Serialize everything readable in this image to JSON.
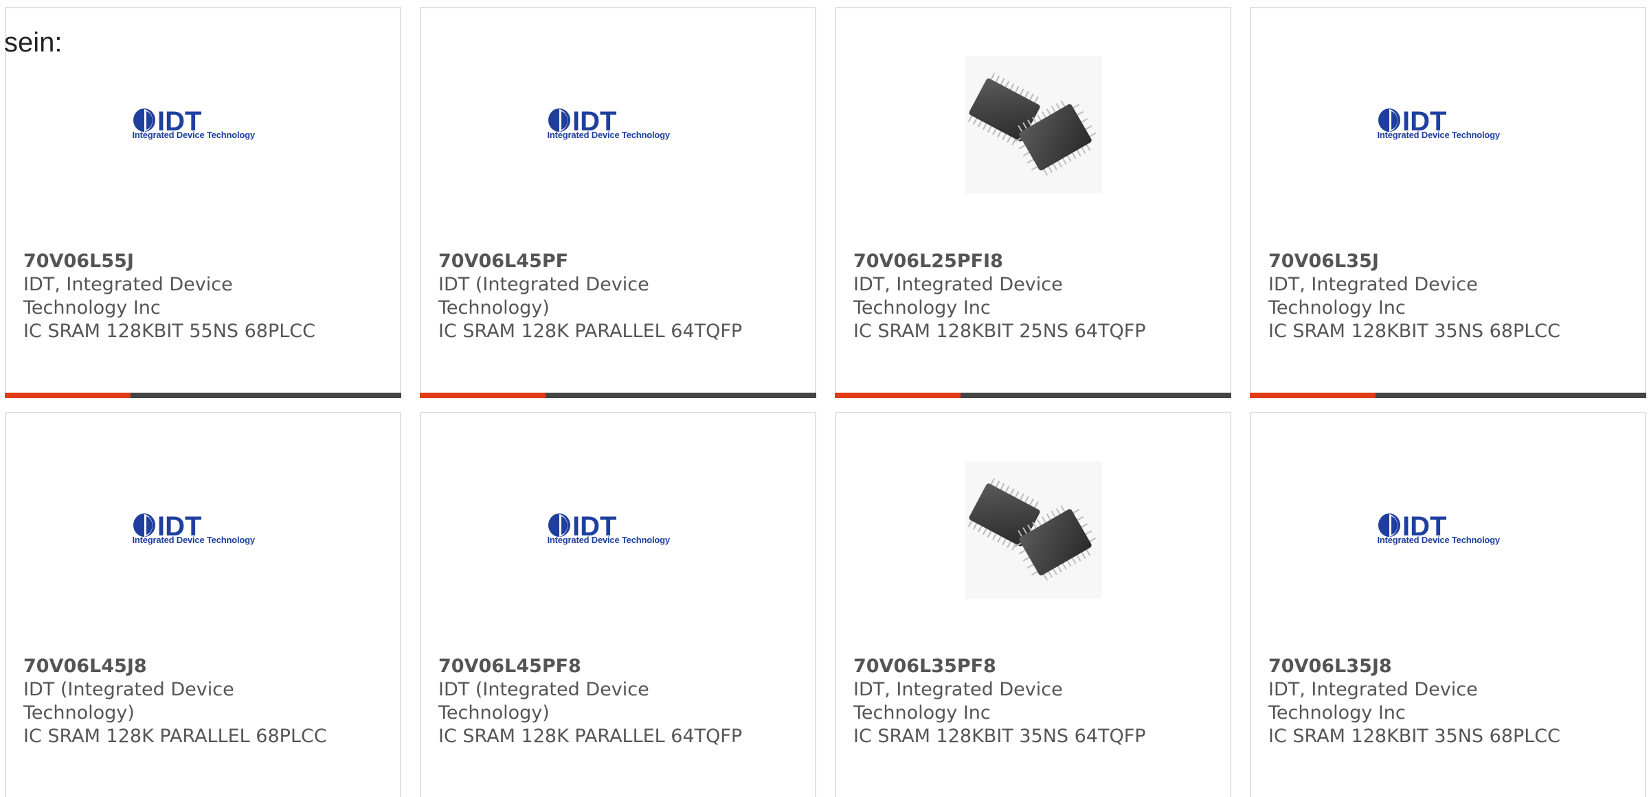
{
  "intro_text": "sein:",
  "colors": {
    "accent": "#e03b12",
    "bar": "#444444",
    "text": "#555555",
    "idt_blue": "#1e3f9e"
  },
  "logo": {
    "wordmark": "IDT",
    "tagline": "Integrated Device Technology"
  },
  "cards": [
    {
      "part": "70V06L55J",
      "manufacturer": "IDT, Integrated Device Technology Inc",
      "description": "IC SRAM 128KBIT 55NS 68PLCC",
      "image": "idt-logo"
    },
    {
      "part": "70V06L45PF",
      "manufacturer": "IDT (Integrated Device Technology)",
      "description": "IC SRAM 128K PARALLEL 64TQFP",
      "image": "idt-logo"
    },
    {
      "part": "70V06L25PFI8",
      "manufacturer": "IDT, Integrated Device Technology Inc",
      "description": "IC SRAM 128KBIT 25NS 64TQFP",
      "image": "chip-photo"
    },
    {
      "part": "70V06L35J",
      "manufacturer": "IDT, Integrated Device Technology Inc",
      "description": "IC SRAM 128KBIT 35NS 68PLCC",
      "image": "idt-logo"
    },
    {
      "part": "70V06L45J8",
      "manufacturer": "IDT (Integrated Device Technology)",
      "description": "IC SRAM 128K PARALLEL 68PLCC",
      "image": "idt-logo"
    },
    {
      "part": "70V06L45PF8",
      "manufacturer": "IDT (Integrated Device Technology)",
      "description": "IC SRAM 128K PARALLEL 64TQFP",
      "image": "idt-logo"
    },
    {
      "part": "70V06L35PF8",
      "manufacturer": "IDT, Integrated Device Technology Inc",
      "description": "IC SRAM 128KBIT 35NS 64TQFP",
      "image": "chip-photo"
    },
    {
      "part": "70V06L35J8",
      "manufacturer": "IDT, Integrated Device Technology Inc",
      "description": "IC SRAM 128KBIT 35NS 68PLCC",
      "image": "idt-logo"
    }
  ]
}
